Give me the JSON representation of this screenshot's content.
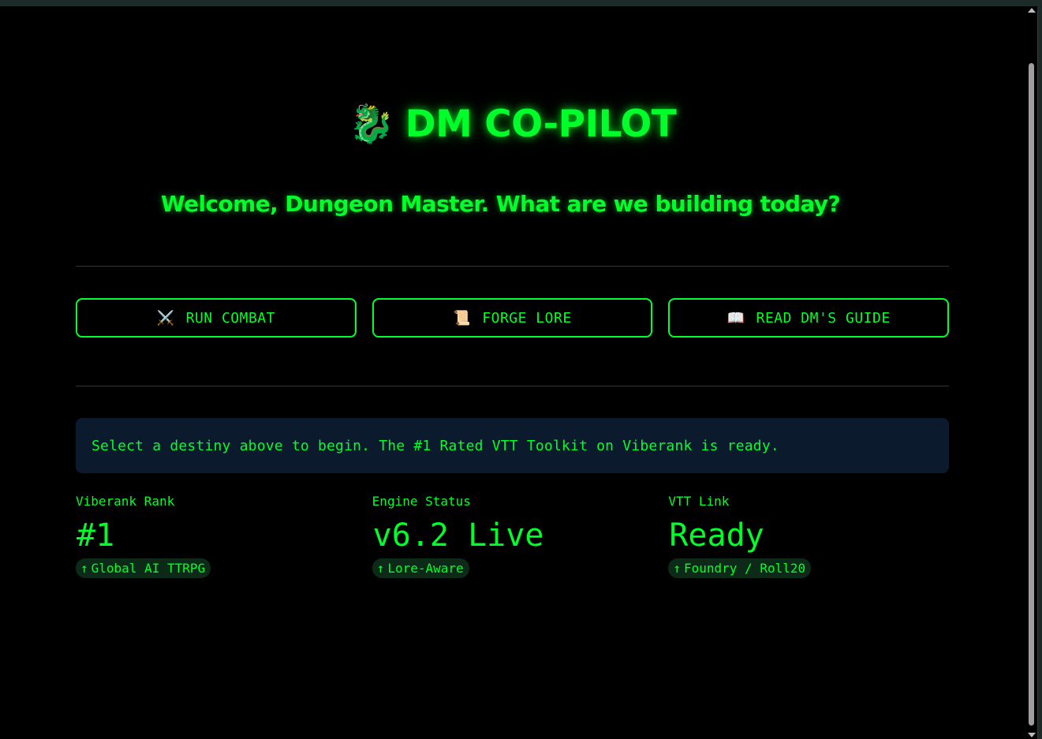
{
  "app": {
    "title": "DM CO-PILOT",
    "title_icon": "dragon-icon",
    "subtitle": "Welcome, Dungeon Master. What are we building today?"
  },
  "buttons": [
    {
      "label": "RUN COMBAT",
      "icon": "crossed-swords-icon",
      "glyph": "⚔️"
    },
    {
      "label": "FORGE LORE",
      "icon": "scroll-icon",
      "glyph": "📜"
    },
    {
      "label": "READ DM'S GUIDE",
      "icon": "open-book-icon",
      "glyph": "📖"
    }
  ],
  "notice": "Select a destiny above to begin. The #1 Rated VTT Toolkit on Viberank is ready.",
  "metrics": [
    {
      "label": "Viberank Rank",
      "value": "#1",
      "delta": "Global AI TTRPG"
    },
    {
      "label": "Engine Status",
      "value": "v6.2 Live",
      "delta": "Lore-Aware"
    },
    {
      "label": "VTT Link",
      "value": "Ready",
      "delta": "Foundry / Roll20"
    }
  ],
  "colors": {
    "accent": "#00ff2a",
    "background": "#000000",
    "notice_bg": "#0b1b2d",
    "delta_bg": "#0d2a18"
  }
}
